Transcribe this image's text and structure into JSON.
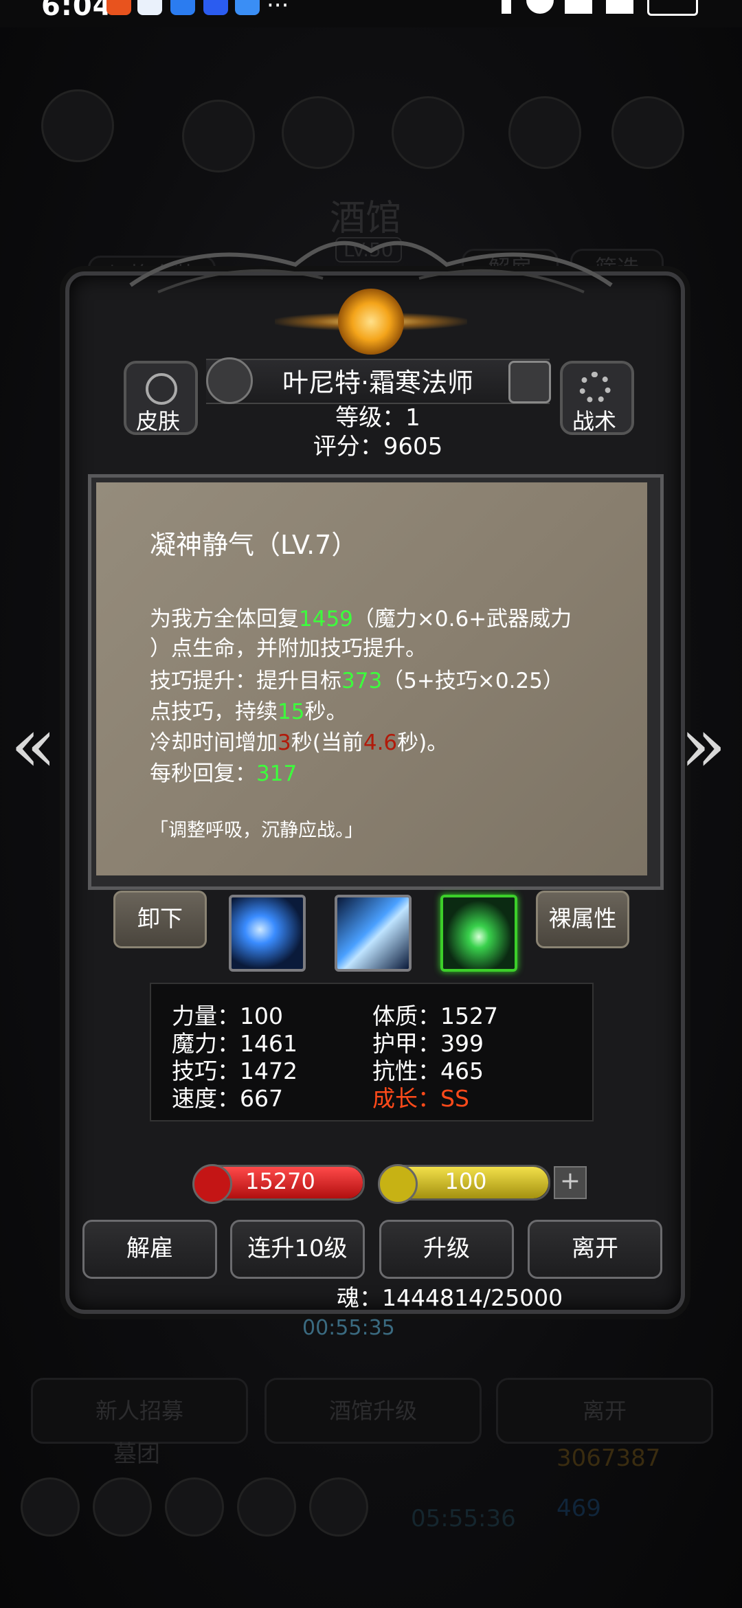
{
  "status_bar": {
    "time": "6:04",
    "more": "···"
  },
  "background": {
    "tavern_title": "酒馆",
    "tavern_level": "LV.50",
    "switch_outfit": "切换套装",
    "dismiss": "解雇",
    "filter": "筛选",
    "bottom_buttons": [
      "新人招募",
      "酒馆升级",
      "离开"
    ],
    "group_label": "墓团",
    "gold": "3067387",
    "gems": "469",
    "timer_bottom": "05:55:36"
  },
  "hero": {
    "skin_label": "皮肤",
    "tactics_label": "战术",
    "name": "叶尼特·霜寒法师",
    "level_line": "等级：1",
    "score_line": "评分：9605"
  },
  "skill": {
    "title": "凝神静气（LV.7）",
    "lines": [
      {
        "parts": [
          {
            "t": "为我方全体回复",
            "c": ""
          },
          {
            "t": "1459",
            "c": "g"
          },
          {
            "t": "（魔力×0.6+武器威力",
            "c": ""
          }
        ]
      },
      {
        "parts": [
          {
            "t": "）点生命，并附加技巧提升。",
            "c": ""
          }
        ]
      },
      {
        "parts": [
          {
            "t": "技巧提升：提升目标",
            "c": ""
          },
          {
            "t": "373",
            "c": "g"
          },
          {
            "t": "（5+技巧×0.25）",
            "c": ""
          }
        ]
      },
      {
        "parts": [
          {
            "t": "点技巧，持续",
            "c": ""
          },
          {
            "t": "15",
            "c": "g"
          },
          {
            "t": "秒。",
            "c": ""
          }
        ]
      },
      {
        "parts": [
          {
            "t": "冷却时间增加",
            "c": ""
          },
          {
            "t": "3",
            "c": "r"
          },
          {
            "t": "秒(当前",
            "c": ""
          },
          {
            "t": "4.6",
            "c": "r"
          },
          {
            "t": "秒)。",
            "c": ""
          }
        ]
      },
      {
        "parts": [
          {
            "t": "每秒回复：",
            "c": ""
          },
          {
            "t": "317",
            "c": "g"
          }
        ]
      }
    ],
    "quote": "「调整呼吸，沉静应战。」"
  },
  "skill_row": {
    "unequip": "卸下",
    "base_attr": "裸属性"
  },
  "stats": {
    "left": [
      "力量：100",
      "魔力：1461",
      "技巧：1472",
      "速度：667"
    ],
    "right": [
      "体质：1527",
      "护甲：399",
      "抗性：465"
    ],
    "growth": "成长：SS"
  },
  "bars": {
    "hp": "15270",
    "hp_fraction": 1.0,
    "energy": "100",
    "energy_fraction": 1.0,
    "plus": "+"
  },
  "actions": [
    "解雇",
    "连升10级",
    "升级",
    "离开"
  ],
  "soul": "魂：1444814/25000",
  "timer": "00:55:35",
  "colors": {
    "green": "#3cff3c",
    "red": "#b11a0a",
    "growth": "#ff4a1a"
  }
}
